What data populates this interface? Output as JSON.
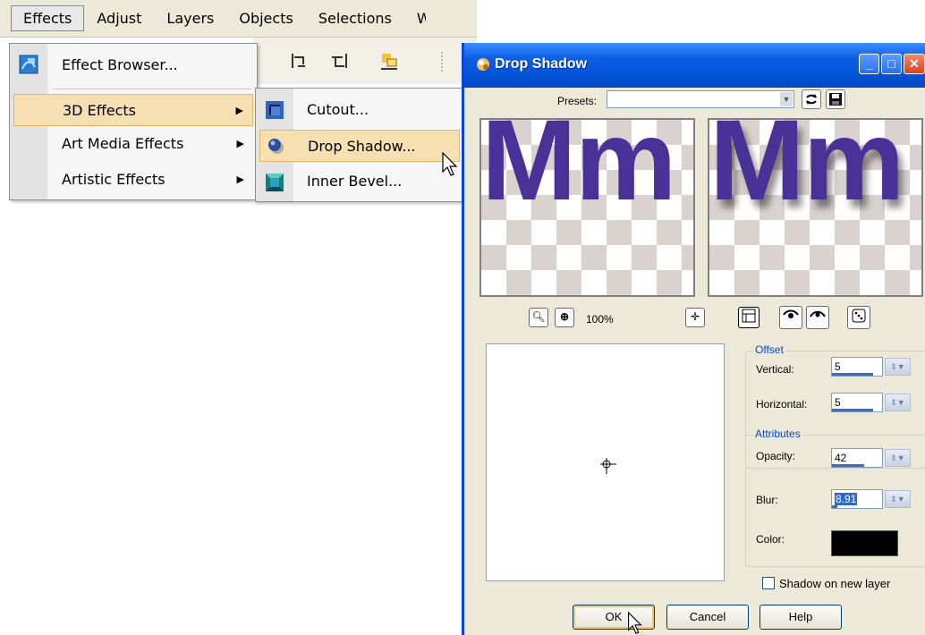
{
  "menubar": {
    "items": [
      "Effects",
      "Adjust",
      "Layers",
      "Objects",
      "Selections",
      "W"
    ]
  },
  "effects_menu": {
    "effect_browser": "Effect Browser...",
    "items": [
      {
        "label": "3D Effects"
      },
      {
        "label": "Art Media Effects"
      },
      {
        "label": "Artistic Effects"
      }
    ]
  },
  "submenu_3d": {
    "items": [
      "Cutout...",
      "Drop Shadow...",
      "Inner Bevel..."
    ]
  },
  "dialog": {
    "title": "Drop Shadow",
    "presets_label": "Presets:",
    "presets_value": "",
    "preview_text_before": "Mm",
    "preview_text_after": "Mm",
    "zoom_level": "100%",
    "offset": {
      "group_label": "Offset",
      "vertical_label": "Vertical:",
      "vertical_value": "5",
      "horizontal_label": "Horizontal:",
      "horizontal_value": "5"
    },
    "attributes": {
      "group_label": "Attributes",
      "opacity_label": "Opacity:",
      "opacity_value": "42",
      "blur_label": "Blur:",
      "blur_value": "8.91",
      "color_label": "Color:",
      "color_value": "#000000"
    },
    "shadow_on_new_layer": {
      "label": "Shadow on new layer",
      "checked": false
    },
    "buttons": {
      "ok": "OK",
      "cancel": "Cancel",
      "help": "Help"
    }
  },
  "colors": {
    "menu_highlight": "#f6dfb0",
    "titlebar_blue": "#0553d8",
    "preview_text": "#4a3197",
    "dialog_bg": "#ece9d8"
  }
}
